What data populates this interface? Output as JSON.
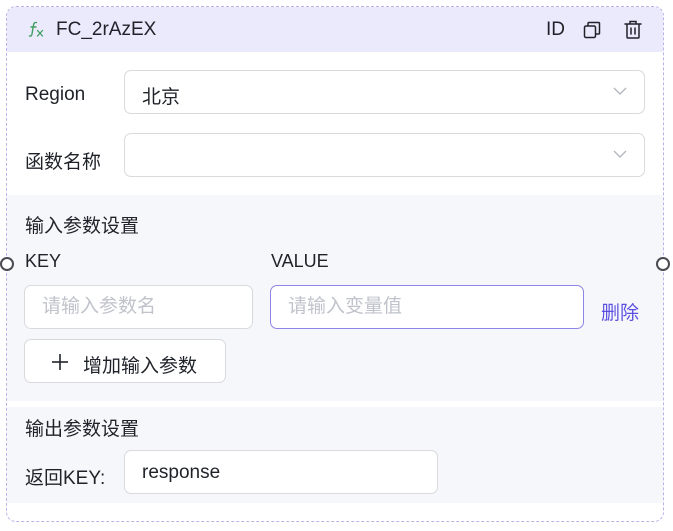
{
  "node": {
    "title": "FC_2rAzEX",
    "id_label": "ID",
    "icons": {
      "function": "fx-icon",
      "copy": "copy-icon",
      "delete": "trash-icon"
    }
  },
  "region": {
    "label": "Region",
    "value": "北京"
  },
  "function_name": {
    "label": "函数名称",
    "value": ""
  },
  "input_params": {
    "section_title": "输入参数设置",
    "key_header": "KEY",
    "value_header": "VALUE",
    "rows": [
      {
        "key_placeholder": "请输入参数名",
        "value_placeholder": "请输入变量值",
        "delete_label": "删除"
      }
    ],
    "add_button_label": "增加输入参数"
  },
  "output_params": {
    "section_title": "输出参数设置",
    "return_key_label": "返回KEY:",
    "return_key_value": "response"
  },
  "colors": {
    "accent": "#5b51e0",
    "header_bg": "#ebe9fc",
    "section_bg": "#f6f7fb"
  }
}
